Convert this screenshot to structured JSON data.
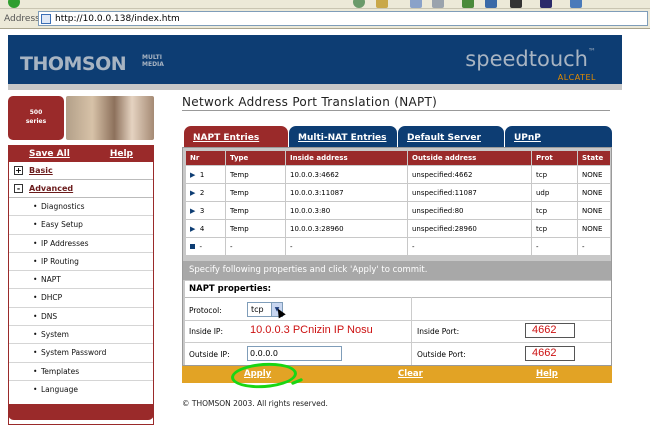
{
  "browser": {
    "address_label": "Address",
    "url": "http://10.0.0.138/index.htm"
  },
  "header": {
    "brand": "THOMSON",
    "brand_sub": "MULTI MEDIA",
    "product": "speedtouch",
    "product_tm": "™",
    "partner": "ALCATEL",
    "colors": {
      "header_bg": "#0d3d73",
      "accent_red": "#9a2a2a",
      "accent_orange": "#e08a00"
    }
  },
  "series_badge": {
    "line1": "500",
    "line2": "series"
  },
  "left_nav": {
    "save_all": "Save All",
    "help": "Help",
    "groups": [
      {
        "label": "Basic",
        "state": "+"
      },
      {
        "label": "Advanced",
        "state": "-"
      }
    ],
    "items": [
      "Diagnostics",
      "Easy Setup",
      "IP Addresses",
      "IP Routing",
      "NAPT",
      "DHCP",
      "DNS",
      "System",
      "System Password",
      "Templates",
      "Language"
    ]
  },
  "main": {
    "title": "Network Address Port Translation (NAPT)",
    "tabs": [
      "NAPT Entries",
      "Multi-NAT Entries",
      "Default Server",
      "UPnP"
    ],
    "table": {
      "headers": [
        "Nr",
        "Type",
        "Inside address",
        "Outside address",
        "Prot",
        "State"
      ],
      "rows": [
        [
          "1",
          "Temp",
          "10.0.0.3:4662",
          "unspecified:4662",
          "tcp",
          "NONE"
        ],
        [
          "2",
          "Temp",
          "10.0.0.3:11087",
          "unspecified:11087",
          "udp",
          "NONE"
        ],
        [
          "3",
          "Temp",
          "10.0.0.3:80",
          "unspecified:80",
          "tcp",
          "NONE"
        ],
        [
          "4",
          "Temp",
          "10.0.0.3:28960",
          "unspecified:28960",
          "tcp",
          "NONE"
        ]
      ],
      "new_row": [
        "-",
        "-",
        "-",
        "-",
        "-",
        "-"
      ]
    },
    "info": "Specify following properties and click 'Apply' to commit.",
    "props": {
      "title": "NAPT properties:",
      "protocol_label": "Protocol:",
      "protocol_value": "tcp",
      "inside_ip_label": "Inside IP:",
      "inside_ip_value": "10.0.0.3  PCnizin IP Nosu",
      "outside_ip_label": "Outside IP:",
      "outside_ip_value": "0.0.0.0",
      "inside_port_label": "Inside Port:",
      "inside_port_value": "4662",
      "outside_port_label": "Outside Port:",
      "outside_port_value": "4662"
    },
    "actions": {
      "apply": "Apply",
      "clear": "Clear",
      "help": "Help"
    },
    "copyright": "© THOMSON 2003. All rights reserved."
  }
}
